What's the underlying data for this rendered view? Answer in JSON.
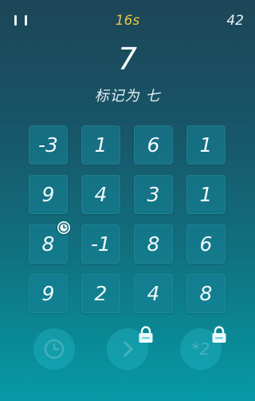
{
  "timer": "16s",
  "score": "42",
  "target_number": "7",
  "instruction": "标记为 七",
  "grid": [
    [
      "-3",
      "1",
      "6",
      "1"
    ],
    [
      "9",
      "4",
      "3",
      "1"
    ],
    [
      "8",
      "-1",
      "8",
      "6"
    ],
    [
      "9",
      "2",
      "4",
      "8"
    ]
  ],
  "powerups": {
    "multiply_label": "*2"
  },
  "icons": {
    "pause": "pause-icon",
    "clock_badge": "clock-icon",
    "timer_powerup": "clock-icon",
    "skip_powerup": "chevron-right-icon",
    "lock": "lock-icon"
  },
  "colors": {
    "timer": "#e9c640",
    "background_top": "#1c4657",
    "background_bottom": "#069aa6",
    "tile": "#1b7e8f"
  }
}
